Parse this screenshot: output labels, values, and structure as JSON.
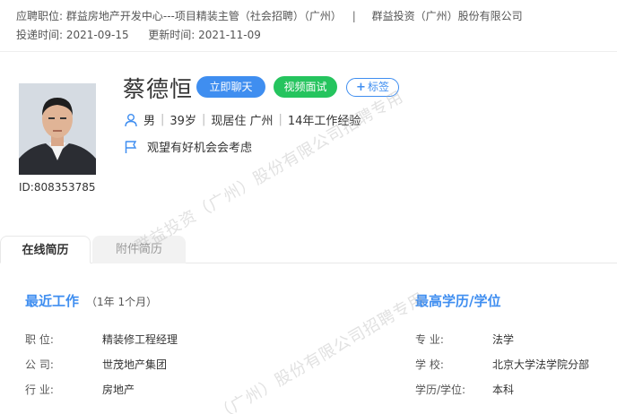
{
  "header": {
    "position_label": "应聘职位:",
    "position_value": "群益房地产开发中心---项目精装主管（社会招聘）（广州）",
    "separator": "|",
    "company": "群益投资（广州）股份有限公司",
    "applied_label": "投递时间:",
    "applied_value": "2021-09-15",
    "updated_label": "更新时间:",
    "updated_value": "2021-11-09"
  },
  "candidate": {
    "name": "蔡德恒",
    "id_text": "ID:808353785",
    "gender": "男",
    "age": "39岁",
    "location": "现居住 广州",
    "experience": "14年工作经验",
    "job_intent": "观望有好机会会考虑"
  },
  "actions": {
    "chat": "立即聊天",
    "video": "视频面试",
    "tag_plus": "+",
    "tag": "标签"
  },
  "tabs": [
    {
      "label": "在线简历",
      "active": true
    },
    {
      "label": "附件简历",
      "active": false
    }
  ],
  "recent_work": {
    "title": "最近工作",
    "duration": "（1年 1个月）",
    "rows": [
      {
        "label": "职    位:",
        "value": "精装修工程经理"
      },
      {
        "label": "公    司:",
        "value": "世茂地产集团"
      },
      {
        "label": "行    业:",
        "value": "房地产"
      }
    ]
  },
  "education": {
    "title": "最高学历/学位",
    "rows": [
      {
        "label": "专    业:",
        "value": "法学"
      },
      {
        "label": "学    校:",
        "value": "北京大学法学院分部"
      },
      {
        "label": "学历/学位:",
        "value": "本科"
      }
    ]
  },
  "watermarks": [
    "群益投资（广州）股份有限公司招聘专用",
    "（广州）股份有限公司招聘专用"
  ],
  "colors": {
    "accent": "#3f8ef0",
    "video_green": "#25c45e"
  },
  "icons": {
    "person": "person-icon",
    "flag": "flag-icon"
  }
}
